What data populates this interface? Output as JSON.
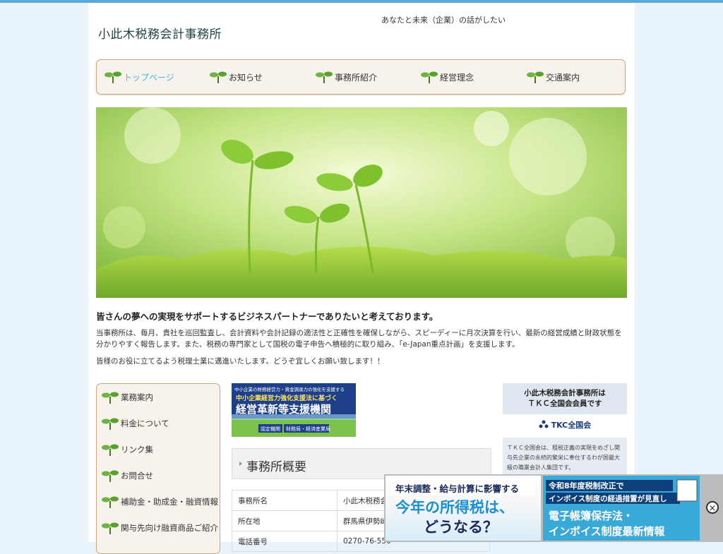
{
  "site": {
    "title": "小此木税務会計事務所",
    "tagline": "あなたと未来（企業）の話がしたい"
  },
  "nav": {
    "items": [
      {
        "label": "トップページ"
      },
      {
        "label": "お知らせ"
      },
      {
        "label": "事務所紹介"
      },
      {
        "label": "経営理念"
      },
      {
        "label": "交通案内"
      }
    ]
  },
  "intro": {
    "heading": "皆さんの夢への実現をサポートするビジネスパートナーでありたいと考えております。",
    "paragraph": "当事務所は、毎月、貴社を巡回監査し、会計資料や会計記録の適法性と正確性を確保しながら、スピーディーに月次決算を行い、最新の経営成績と財政状態を分かりやすく報告します。また、税務の専門家として国税の電子申告へ積極的に取り組み、「e-Japan重点計画」を支援します。",
    "closing": "皆様のお役に立てるよう税理士業に邁進いたします。どうぞ宜しくお願い致します！！"
  },
  "sidebar": {
    "items": [
      {
        "label": "業務案内"
      },
      {
        "label": "料金について"
      },
      {
        "label": "リンク集"
      },
      {
        "label": "お問合せ"
      },
      {
        "label": "補助金・助成金・融資情報"
      },
      {
        "label": "関与先向け融資商品ご紹介"
      }
    ]
  },
  "banner": {
    "line1": "中小企業の財務経営力・資金調達力の強化を支援する",
    "line2": "中小企業経営力強化支援法に基づく",
    "line3": "経営革新等支援機関",
    "badge1": "認定機関",
    "badge2": "財務局・経済産業局"
  },
  "overview": {
    "title": "事務所概要",
    "rows": [
      {
        "key": "事務所名",
        "value": "小此木税務会"
      },
      {
        "key": "所在地",
        "value": "群馬県伊勢崎"
      },
      {
        "key": "電話番号",
        "value": "0270-76-550"
      }
    ]
  },
  "tkc": {
    "member_line1": "小此木税務会計事務所は",
    "member_line2": "ＴＫＣ全国会会員です",
    "logo": "TKC全国会",
    "description": "ＴＫＣ全国会は、租税正義の実現をめざし関与先企業の永続的繁栄に奉仕するわが国最大級の職業会計人集団です。"
  },
  "ad": {
    "left_top": "年末調整・給与計算に影響する",
    "left_main1": "今年の所得税は、",
    "left_main2": "どうなる？",
    "right_top1": "令和8年度税制改正で",
    "right_top2": "インボイス制度の経過措置が見直し",
    "right_main1": "電子帳簿保存法・",
    "right_main2": "インボイス制度最新情報",
    "close": "×"
  }
}
